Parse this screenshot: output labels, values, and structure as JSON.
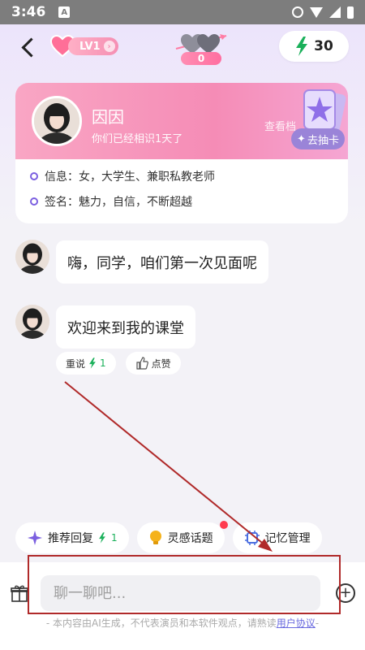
{
  "status_bar": {
    "time": "3:46",
    "a_badge": "A"
  },
  "header": {
    "level": "LV1",
    "heart_count": "0",
    "energy": "30"
  },
  "profile": {
    "name": "因因",
    "known_days": "你们已经相识1天了",
    "view_files": "查看档",
    "draw_card": "去抽卡",
    "info": "信息：女，大学生、兼职私教老师",
    "signature": "签名：魅力，自信，不断超越"
  },
  "messages": [
    {
      "text": "嗨，同学，咱们第一次见面呢"
    },
    {
      "text": "欢迎来到我的课堂"
    }
  ],
  "message_actions": {
    "retry": "重说",
    "retry_cost": "1",
    "like": "点赞"
  },
  "suggestions": [
    {
      "label": "推荐回复",
      "cost": "1"
    },
    {
      "label": "灵感话题"
    },
    {
      "label": "记忆管理"
    }
  ],
  "input": {
    "placeholder": "聊一聊吧..."
  },
  "disclaimer": {
    "text": "- 本内容由AI生成，不代表演员和本软件观点，请熟读",
    "link": "用户协议",
    "end": "-"
  },
  "colors": {
    "accent": "#7b5fe0",
    "pink": "#f58cb6",
    "energy_green": "#1ab05a",
    "annotation_red": "#b02a2a"
  }
}
